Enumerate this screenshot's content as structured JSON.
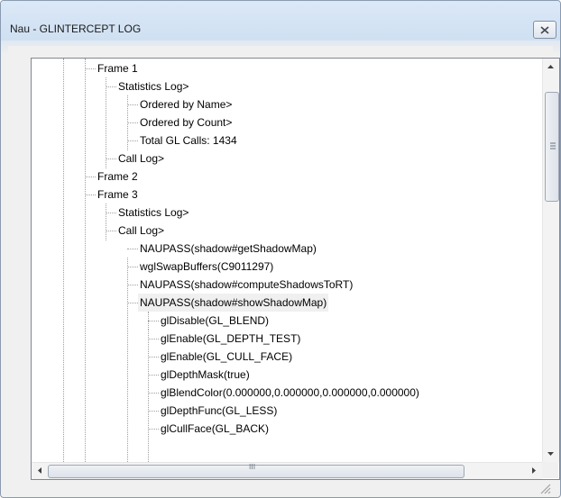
{
  "window": {
    "title": "Nau - GLINTERCEPT LOG"
  },
  "tree": {
    "items": [
      {
        "label": "Frame 1"
      },
      {
        "label": "Statistics Log>"
      },
      {
        "label": "Ordered by Name>"
      },
      {
        "label": "Ordered by Count>"
      },
      {
        "label": "Total GL Calls: 1434"
      },
      {
        "label": "Call Log>"
      },
      {
        "label": "Frame 2"
      },
      {
        "label": "Frame 3"
      },
      {
        "label": "Statistics Log>"
      },
      {
        "label": "Call Log>"
      },
      {
        "label": "NAUPASS(shadow#getShadowMap)"
      },
      {
        "label": "wglSwapBuffers(C9011297)"
      },
      {
        "label": "NAUPASS(shadow#computeShadowsToRT)"
      },
      {
        "label": "NAUPASS(shadow#showShadowMap)"
      },
      {
        "label": "glDisable(GL_BLEND)"
      },
      {
        "label": "glEnable(GL_DEPTH_TEST)"
      },
      {
        "label": "glEnable(GL_CULL_FACE)"
      },
      {
        "label": "glDepthMask(true)"
      },
      {
        "label": "glBlendColor(0.000000,0.000000,0.000000,0.000000)"
      },
      {
        "label": "glDepthFunc(GL_LESS)"
      },
      {
        "label": "glCullFace(GL_BACK)"
      }
    ]
  },
  "scrollbar": {
    "h_thumb_grip": "III"
  },
  "icons": {
    "close": "close-icon",
    "up": "scroll-up-arrow-icon",
    "down": "scroll-down-arrow-icon",
    "left": "scroll-left-arrow-icon",
    "right": "scroll-right-arrow-icon",
    "grip": "resize-grip-icon"
  },
  "colors": {
    "title_bar": "#cfe0f2",
    "selection": "#f0f0f0",
    "tree_lines": "#a0a0a0"
  }
}
